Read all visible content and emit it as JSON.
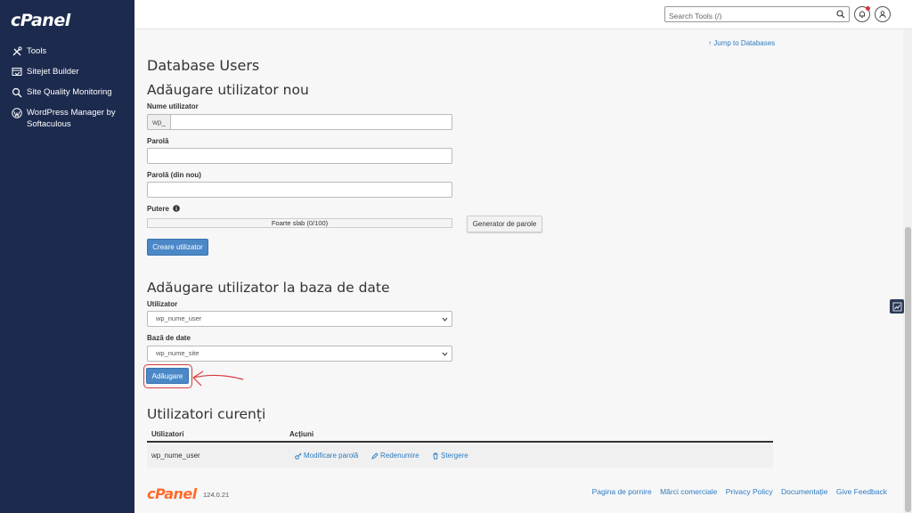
{
  "sidebar": {
    "logo": "cPanel",
    "items": [
      {
        "label": "Tools",
        "icon": "tools-icon"
      },
      {
        "label": "Sitejet Builder",
        "icon": "sitejet-icon"
      },
      {
        "label": "Site Quality Monitoring",
        "icon": "magnifier-icon"
      },
      {
        "label": "WordPress Manager by Softaculous",
        "icon": "wordpress-icon"
      }
    ]
  },
  "topbar": {
    "search_placeholder": "Search Tools (/)"
  },
  "main": {
    "jump_link": "Jump to Databases",
    "page_title": "Database Users",
    "add_user": {
      "heading": "Adăugare utilizator nou",
      "username_label": "Nume utilizator",
      "username_prefix": "wp_",
      "password_label": "Parolă",
      "password_again_label": "Parolă (din nou)",
      "strength_label": "Putere",
      "strength_value": "Foarte slab (0/100)",
      "strength_percent": 0,
      "generator_button": "Generator de parole",
      "create_button": "Creare utilizator"
    },
    "add_to_db": {
      "heading": "Adăugare utilizator la baza de date",
      "user_label": "Utilizator",
      "user_selected": "wp_nume_user",
      "db_label": "Bază de date",
      "db_selected": "wp_nume_site",
      "add_button": "Adăugare"
    },
    "current_users": {
      "heading": "Utilizatori curenți",
      "columns": [
        "Utilizatori",
        "Acțiuni"
      ],
      "rows": [
        {
          "user": "wp_nume_user",
          "actions": [
            "Modificare parolă",
            "Redenumire",
            "Ștergere"
          ]
        }
      ]
    }
  },
  "footer": {
    "logo": "cPanel",
    "version": "124.0.21",
    "links": [
      "Pagina de pornire",
      "Mărci comerciale",
      "Privacy Policy",
      "Documentație",
      "Give Feedback"
    ]
  },
  "colors": {
    "sidebar_bg": "#1c2a4e",
    "primary": "#4a88c7",
    "link": "#2d7cc1",
    "brand_orange": "#ff6c2c",
    "highlight": "#d93a3a"
  }
}
